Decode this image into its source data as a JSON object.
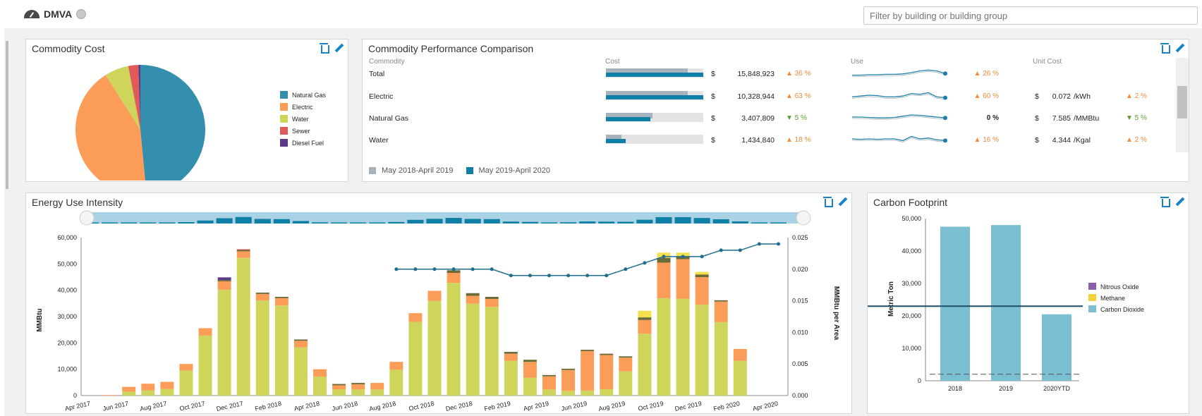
{
  "header": {
    "site": "DMVA",
    "filter_placeholder": "Filter by building or building group"
  },
  "commodity_cost": {
    "title": "Commodity Cost",
    "legend": [
      {
        "label": "Natural Gas",
        "color": "#348ead"
      },
      {
        "label": "Electric",
        "color": "#fb9c59"
      },
      {
        "label": "Water",
        "color": "#cfd45a"
      },
      {
        "label": "Sewer",
        "color": "#e05a5a"
      },
      {
        "label": "Diesel Fuel",
        "color": "#5b3a8a"
      }
    ],
    "chart_data": {
      "type": "pie",
      "labels": [
        "Natural Gas",
        "Electric",
        "Water",
        "Sewer",
        "Diesel Fuel"
      ],
      "values": [
        48.5,
        42.5,
        6,
        2.5,
        0.5
      ]
    }
  },
  "comparison": {
    "title": "Commodity Performance Comparison",
    "headers": {
      "commodity": "Commodity",
      "cost": "Cost",
      "use": "Use",
      "unit_cost": "Unit Cost"
    },
    "rows": [
      {
        "name": "Total",
        "cost_sym": "$",
        "cost": "15,848,923",
        "cost_chg": "36 %",
        "cost_dir": "up",
        "use_chg": "26 %",
        "use_dir": "up",
        "unit_sym": "",
        "unit": "",
        "unit_label": "",
        "unit_chg": "",
        "unit_dir": "",
        "prev": 0.84,
        "cur": 1.0
      },
      {
        "name": "Electric",
        "cost_sym": "$",
        "cost": "10,328,944",
        "cost_chg": "63 %",
        "cost_dir": "up",
        "use_chg": "60 %",
        "use_dir": "up",
        "unit_sym": "$",
        "unit": "0.072",
        "unit_label": "/kWh",
        "unit_chg": "2 %",
        "unit_dir": "up",
        "prev": 0.84,
        "cur": 1.0
      },
      {
        "name": "Natural Gas",
        "cost_sym": "$",
        "cost": "3,407,809",
        "cost_chg": "5 %",
        "cost_dir": "down",
        "use_chg": "0 %",
        "use_dir": "none",
        "unit_sym": "$",
        "unit": "7.585",
        "unit_label": "/MMBtu",
        "unit_chg": "5 %",
        "unit_dir": "down",
        "prev": 0.48,
        "cur": 0.46
      },
      {
        "name": "Water",
        "cost_sym": "$",
        "cost": "1,434,840",
        "cost_chg": "18 %",
        "cost_dir": "up",
        "use_chg": "16 %",
        "use_dir": "up",
        "unit_sym": "$",
        "unit": "4.344",
        "unit_label": "/Kgal",
        "unit_chg": "2 %",
        "unit_dir": "up",
        "prev": 0.16,
        "cur": 0.2
      }
    ],
    "legend": [
      {
        "label": "May 2018-April 2019",
        "color": "#a7b3bc"
      },
      {
        "label": "May 2019-April 2020",
        "color": "#0f7fa6"
      }
    ]
  },
  "eui": {
    "title": "Energy Use Intensity",
    "ylabel": "MMBtu",
    "y2label": "MMBtu per Area",
    "chart_data": {
      "type": "bar",
      "ylim": [
        0,
        60000
      ],
      "y2lim": [
        0,
        0.025
      ],
      "yticks": [
        "0",
        "10,000",
        "20,000",
        "30,000",
        "40,000",
        "50,000",
        "60,000"
      ],
      "y2ticks": [
        "0.000",
        "0.005",
        "0.010",
        "0.015",
        "0.020",
        "0.025"
      ],
      "xticklabels": [
        "Apr 2017",
        "Jun 2017",
        "Aug 2017",
        "Oct 2017",
        "Dec 2017",
        "Feb 2018",
        "Apr 2018",
        "Jun 2018",
        "Aug 2018",
        "Oct 2018",
        "Dec 2018",
        "Feb 2019",
        "Apr 2019",
        "Jun 2019",
        "Aug 2019",
        "Oct 2019",
        "Dec 2019",
        "Feb 2020",
        "Apr 2020"
      ],
      "categories": [
        "Apr 2017",
        "May 2017",
        "Jun 2017",
        "Jul 2017",
        "Aug 2017",
        "Sep 2017",
        "Oct 2017",
        "Nov 2017",
        "Dec 2017",
        "Jan 2018",
        "Feb 2018",
        "Mar 2018",
        "Apr 2018",
        "May 2018",
        "Jun 2018",
        "Jul 2018",
        "Aug 2018",
        "Sep 2018",
        "Oct 2018",
        "Nov 2018",
        "Dec 2018",
        "Jan 2019",
        "Feb 2019",
        "Mar 2019",
        "Apr 2019",
        "May 2019",
        "Jun 2019",
        "Jul 2019",
        "Aug 2019",
        "Sep 2019",
        "Oct 2019",
        "Nov 2019",
        "Dec 2019",
        "Jan 2020",
        "Feb 2020",
        "Mar 2020",
        "Apr 2020"
      ],
      "series": [
        {
          "name": "Natural Gas",
          "color": "#cfd45a",
          "values": [
            0,
            0,
            0,
            1500,
            0,
            2000,
            0,
            2500,
            0,
            9500,
            0,
            22800,
            0,
            40200,
            0,
            52300,
            0,
            36100,
            0,
            34200,
            0,
            18300,
            0,
            7200,
            0,
            2300,
            0,
            2300,
            0,
            2300,
            0,
            9800,
            0,
            28000,
            0,
            36000,
            0,
            42800,
            0,
            34900,
            0,
            33700,
            0,
            13200,
            0,
            6800,
            0,
            2300,
            0,
            1800,
            0,
            1900,
            0,
            2400,
            0,
            9200,
            0,
            23500,
            0,
            37000,
            0,
            36800,
            0,
            34500,
            0,
            27900,
            0,
            13200,
            0
          ]
        },
        {
          "name": "Electric",
          "color": "#fb9c59",
          "values": [
            0,
            0,
            0,
            200,
            0,
            1800,
            0,
            2500,
            0,
            2700,
            0,
            2500,
            0,
            2800,
            0,
            3200,
            0,
            2500,
            0,
            5000,
            0,
            3200,
            0,
            2500,
            0,
            2800,
            0,
            1600,
            0,
            2000,
            0,
            2500,
            0,
            3000,
            0,
            3300,
            0,
            3800,
            0,
            1800,
            0,
            3000,
            0,
            2700,
            0,
            2000,
            0,
            5000,
            0,
            6000,
            0,
            7900,
            0,
            15000,
            0,
            13000,
            0,
            6500,
            0,
            5200,
            0,
            13500,
            0,
            15000,
            0,
            10500,
            0,
            7800,
            0,
            4500,
            0
          ]
        },
        {
          "name": "Water",
          "color": "#6b6b3a",
          "values": [
            0,
            0,
            0,
            0,
            0,
            0,
            0,
            0,
            0,
            0,
            0,
            0,
            0,
            0,
            0,
            500,
            0,
            500,
            0,
            500,
            0,
            500,
            0,
            0,
            0,
            500,
            0,
            500,
            0,
            500,
            0,
            500,
            0,
            0,
            0,
            0,
            0,
            1000,
            0,
            1000,
            0,
            800,
            0,
            700,
            0,
            800,
            0,
            500,
            0,
            500,
            0,
            500,
            0,
            500,
            0,
            500,
            0,
            500,
            0,
            1500,
            0,
            1800,
            0,
            1000,
            0,
            500,
            0,
            0,
            0
          ]
        },
        {
          "name": "Sewer",
          "color": "#e05a5a",
          "values": [
            0,
            0,
            0,
            0,
            0,
            0,
            0,
            0,
            0,
            0,
            0,
            0,
            0,
            0,
            0,
            300,
            0,
            0,
            0,
            0,
            0,
            0,
            0,
            0,
            0,
            0,
            0,
            0,
            0,
            0,
            0,
            0,
            0,
            0,
            0,
            0,
            0,
            0,
            0,
            0,
            0,
            0,
            0,
            0,
            0,
            0,
            0,
            0,
            0,
            0,
            0,
            0,
            0,
            0,
            0,
            0,
            0,
            0,
            0,
            0,
            0,
            0,
            0,
            0,
            0,
            0,
            0,
            0,
            0
          ]
        },
        {
          "name": "Diesel Fuel",
          "color": "#5b3a8a",
          "values": [
            0,
            0,
            0,
            0,
            0,
            0,
            0,
            0,
            0,
            0,
            0,
            0,
            0,
            0,
            0,
            1000,
            0,
            0,
            0,
            0,
            0,
            0,
            0,
            0,
            0,
            0,
            0,
            0,
            0,
            0,
            0,
            0,
            0,
            0,
            0,
            0,
            0,
            0,
            0,
            0,
            0,
            0,
            0,
            0,
            0,
            0,
            0,
            0,
            0,
            0,
            0,
            0,
            0,
            0,
            0,
            0,
            0,
            0,
            0,
            0,
            0,
            0,
            0,
            0,
            0,
            0,
            0,
            0,
            0
          ]
        },
        {
          "name": "Methane",
          "color": "#f3e04a",
          "values": [
            0,
            0,
            0,
            0,
            0,
            0,
            0,
            0,
            0,
            0,
            0,
            0,
            0,
            0,
            0,
            0,
            0,
            0,
            0,
            0,
            0,
            0,
            0,
            0,
            0,
            0,
            0,
            0,
            0,
            0,
            0,
            0,
            0,
            0,
            0,
            0,
            0,
            0,
            0,
            0,
            0,
            0,
            0,
            0,
            0,
            0,
            0,
            0,
            0,
            0,
            0,
            0,
            0,
            0,
            0,
            0,
            0,
            0,
            0,
            2500,
            0,
            2000,
            0,
            1500,
            0,
            1000,
            0,
            0,
            0
          ]
        }
      ],
      "bars": [
        {
          "x": "Apr 2017",
          "stack": [
            0,
            0,
            0,
            0,
            0,
            0
          ]
        },
        {
          "x": "May 2017",
          "stack": [
            0,
            200,
            0,
            0,
            0,
            0
          ]
        },
        {
          "x": "Jun 2017",
          "stack": [
            1500,
            1800,
            0,
            0,
            0,
            0
          ]
        },
        {
          "x": "Jul 2017",
          "stack": [
            2000,
            2500,
            0,
            0,
            0,
            0
          ]
        },
        {
          "x": "Aug 2017",
          "stack": [
            2500,
            2700,
            0,
            0,
            0,
            0
          ]
        },
        {
          "x": "Sep 2017",
          "stack": [
            9500,
            2500,
            0,
            0,
            0,
            0
          ]
        },
        {
          "x": "Oct 2017",
          "stack": [
            22800,
            2800,
            0,
            0,
            0,
            0
          ]
        },
        {
          "x": "Nov 2017",
          "stack": [
            40200,
            3200,
            500,
            0,
            1000,
            0
          ]
        },
        {
          "x": "Dec 2017",
          "stack": [
            52300,
            2500,
            500,
            300,
            0,
            0
          ]
        },
        {
          "x": "Jan 2018",
          "stack": [
            36100,
            2500,
            500,
            0,
            0,
            0
          ]
        },
        {
          "x": "Feb 2018",
          "stack": [
            34200,
            2800,
            500,
            0,
            0,
            0
          ]
        },
        {
          "x": "Mar 2018",
          "stack": [
            18300,
            2500,
            500,
            0,
            0,
            0
          ]
        },
        {
          "x": "Apr 2018",
          "stack": [
            7200,
            2800,
            0,
            0,
            0,
            0
          ]
        },
        {
          "x": "May 2018",
          "stack": [
            2300,
            1600,
            500,
            0,
            0,
            0
          ]
        },
        {
          "x": "Jun 2018",
          "stack": [
            2300,
            2000,
            500,
            0,
            0,
            0
          ]
        },
        {
          "x": "Jul 2018",
          "stack": [
            2300,
            2500,
            0,
            0,
            0,
            0
          ]
        },
        {
          "x": "Aug 2018",
          "stack": [
            9800,
            3000,
            0,
            0,
            0,
            0
          ]
        },
        {
          "x": "Sep 2018",
          "stack": [
            28000,
            3300,
            0,
            0,
            0,
            0
          ]
        },
        {
          "x": "Oct 2018",
          "stack": [
            36000,
            3800,
            0,
            0,
            0,
            0
          ]
        },
        {
          "x": "Nov 2018",
          "stack": [
            42800,
            3800,
            1000,
            0,
            0,
            0
          ]
        },
        {
          "x": "Dec 2018",
          "stack": [
            34900,
            3000,
            1000,
            0,
            0,
            0
          ]
        },
        {
          "x": "Jan 2019",
          "stack": [
            33700,
            3000,
            800,
            0,
            0,
            0
          ]
        },
        {
          "x": "Feb 2019",
          "stack": [
            13200,
            2700,
            700,
            0,
            0,
            0
          ]
        },
        {
          "x": "Mar 2019",
          "stack": [
            6800,
            6000,
            800,
            0,
            0,
            0
          ]
        },
        {
          "x": "Apr 2019",
          "stack": [
            2300,
            5000,
            500,
            0,
            0,
            0
          ]
        },
        {
          "x": "May 2019",
          "stack": [
            1800,
            7900,
            500,
            0,
            0,
            0
          ]
        },
        {
          "x": "Jun 2019",
          "stack": [
            1900,
            15000,
            500,
            0,
            0,
            0
          ]
        },
        {
          "x": "Jul 2019",
          "stack": [
            2400,
            13000,
            500,
            0,
            0,
            0
          ]
        },
        {
          "x": "Aug 2019",
          "stack": [
            9200,
            5200,
            500,
            0,
            0,
            0
          ]
        },
        {
          "x": "Sep 2019",
          "stack": [
            23500,
            5200,
            1000,
            0,
            0,
            2500
          ]
        },
        {
          "x": "Oct 2019",
          "stack": [
            37000,
            13500,
            1800,
            0,
            0,
            2000
          ]
        },
        {
          "x": "Nov 2019",
          "stack": [
            36800,
            15000,
            1000,
            0,
            0,
            1500
          ]
        },
        {
          "x": "Dec 2019",
          "stack": [
            34500,
            10500,
            1000,
            0,
            0,
            1000
          ]
        },
        {
          "x": "Jan 2020",
          "stack": [
            27900,
            7800,
            500,
            0,
            0,
            0
          ]
        },
        {
          "x": "Feb 2020",
          "stack": [
            13200,
            4500,
            0,
            0,
            0,
            0
          ]
        },
        {
          "x": "Mar 2020",
          "stack": [
            0,
            0,
            0,
            0,
            0,
            0
          ]
        },
        {
          "x": "Apr 2020",
          "stack": [
            0,
            0,
            0,
            0,
            0,
            0
          ]
        }
      ],
      "line": {
        "name": "MMBtu per Area",
        "color": "#1f6d8f",
        "start_index": 16,
        "values": [
          0.02,
          0.02,
          0.02,
          0.02,
          0.02,
          0.02,
          0.019,
          0.019,
          0.019,
          0.019,
          0.019,
          0.019,
          0.02,
          0.021,
          0.022,
          0.022,
          0.022,
          0.023,
          0.023,
          0.024,
          0.024
        ]
      }
    }
  },
  "carbon": {
    "title": "Carbon Footprint",
    "ylabel": "Metric Ton",
    "legend": [
      {
        "label": "Nitrous Oxide",
        "color": "#8c5fa8"
      },
      {
        "label": "Methane",
        "color": "#f3d33a"
      },
      {
        "label": "Carbon Dioxide",
        "color": "#7bbfd3"
      }
    ],
    "chart_data": {
      "type": "bar",
      "categories": [
        "2018",
        "2019",
        "2020YTD"
      ],
      "values": [
        47500,
        48000,
        20500
      ],
      "ylim": [
        0,
        50000
      ],
      "yticks": [
        "0",
        "10,000",
        "20,000",
        "30,000",
        "40,000",
        "50,000"
      ],
      "reference_line": 23000
    }
  }
}
